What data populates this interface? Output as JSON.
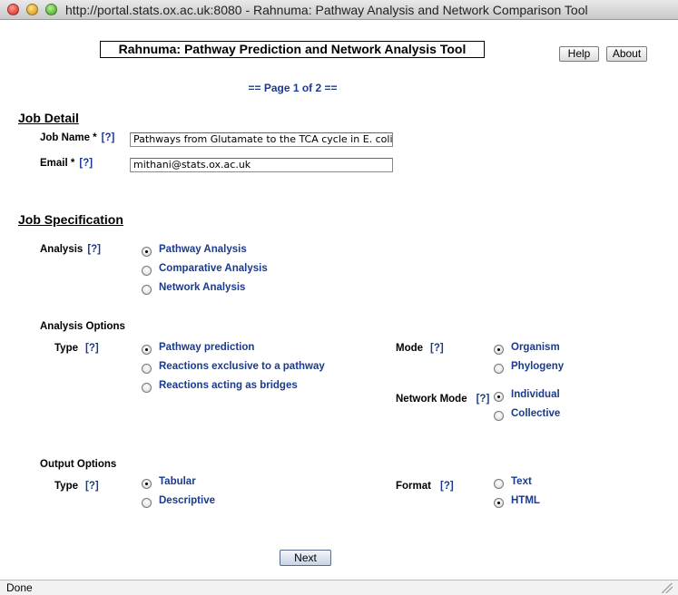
{
  "window": {
    "title": "http://portal.stats.ox.ac.uk:8080 - Rahnuma: Pathway Analysis and Network Comparison Tool"
  },
  "header": {
    "app_title": "Rahnuma: Pathway Prediction and Network Analysis Tool",
    "help_label": "Help",
    "about_label": "About",
    "page_indicator": "== Page 1 of 2 =="
  },
  "job_detail": {
    "title": "Job Detail",
    "job_name_label": "Job Name *",
    "job_name_value": "Pathways from Glutamate to the TCA cycle in E. coli",
    "email_label": "Email *",
    "email_value": "mithani@stats.ox.ac.uk",
    "help_link": "[?]"
  },
  "job_spec": {
    "title": "Job Specification",
    "analysis_label": "Analysis",
    "analysis_options": [
      {
        "label": "Pathway Analysis",
        "selected": true
      },
      {
        "label": "Comparative Analysis",
        "selected": false
      },
      {
        "label": "Network Analysis",
        "selected": false
      }
    ],
    "analysis_options_title": "Analysis Options",
    "type_label": "Type",
    "type_options": [
      {
        "label": "Pathway prediction",
        "selected": true
      },
      {
        "label": "Reactions exclusive to a pathway",
        "selected": false
      },
      {
        "label": "Reactions acting as bridges",
        "selected": false
      }
    ],
    "mode_label": "Mode",
    "mode_options": [
      {
        "label": "Organism",
        "selected": true
      },
      {
        "label": "Phylogeny",
        "selected": false
      }
    ],
    "network_mode_label": "Network Mode",
    "network_mode_options": [
      {
        "label": "Individual",
        "selected": true
      },
      {
        "label": "Collective",
        "selected": false
      }
    ],
    "output_options_title": "Output Options",
    "output_type_label": "Type",
    "output_type_options": [
      {
        "label": "Tabular",
        "selected": true
      },
      {
        "label": "Descriptive",
        "selected": false
      }
    ],
    "format_label": "Format",
    "format_options": [
      {
        "label": "Text",
        "selected": false
      },
      {
        "label": "HTML",
        "selected": true
      }
    ]
  },
  "footer": {
    "next_label": "Next"
  },
  "status": {
    "text": "Done"
  }
}
